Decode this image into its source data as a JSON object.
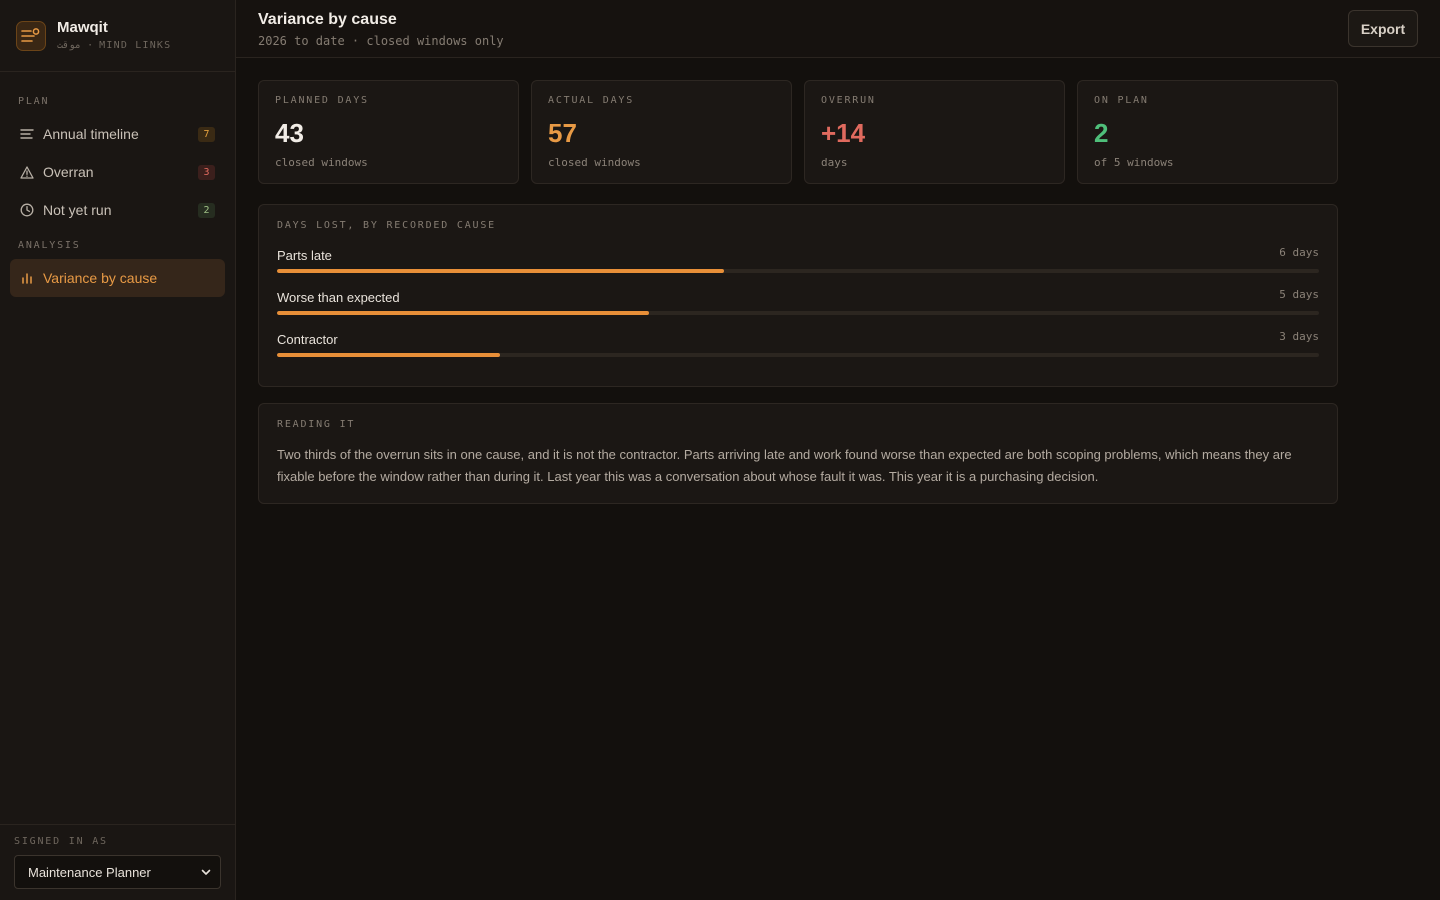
{
  "app": {
    "name": "Mawqit",
    "subtitle": "موقت · MIND LINKS"
  },
  "sidebar": {
    "plan_label": "PLAN",
    "analysis_label": "ANALYSIS",
    "items": [
      {
        "label": "Annual timeline",
        "count": "7"
      },
      {
        "label": "Overran",
        "count": "3"
      },
      {
        "label": "Not yet run",
        "count": "2"
      },
      {
        "label": "Variance by cause"
      }
    ],
    "signed_in_label": "SIGNED IN AS",
    "role": "Maintenance Planner"
  },
  "header": {
    "title": "Variance by cause",
    "subtitle": "2026 to date · closed windows only",
    "export_label": "Export"
  },
  "stats": [
    {
      "label": "PLANNED DAYS",
      "value": "43",
      "note": "closed windows",
      "color": "#f1ece6"
    },
    {
      "label": "ACTUAL DAYS",
      "value": "57",
      "note": "closed windows",
      "color": "#e89a45"
    },
    {
      "label": "OVERRUN",
      "value": "+14",
      "note": "days",
      "color": "#e06a5e"
    },
    {
      "label": "ON PLAN",
      "value": "2",
      "note": "of 5 windows",
      "color": "#4fbf7a"
    }
  ],
  "causes": {
    "title": "DAYS LOST, BY RECORDED CAUSE",
    "max_days": 14,
    "rows": [
      {
        "name": "Parts late",
        "days_label": "6 days",
        "days": 6
      },
      {
        "name": "Worse than expected",
        "days_label": "5 days",
        "days": 5
      },
      {
        "name": "Contractor",
        "days_label": "3 days",
        "days": 3
      }
    ]
  },
  "reading": {
    "title": "READING IT",
    "text": "Two thirds of the overrun sits in one cause, and it is not the contractor. Parts arriving late and work found worse than expected are both scoping problems, which means they are fixable before the window rather than during it. Last year this was a conversation about whose fault it was. This year it is a purchasing decision."
  },
  "colors": {
    "accent": "#e88f38",
    "badge_amber": "#e3a03e",
    "badge_red": "#e06a5e",
    "badge_green": "#78b86e"
  }
}
